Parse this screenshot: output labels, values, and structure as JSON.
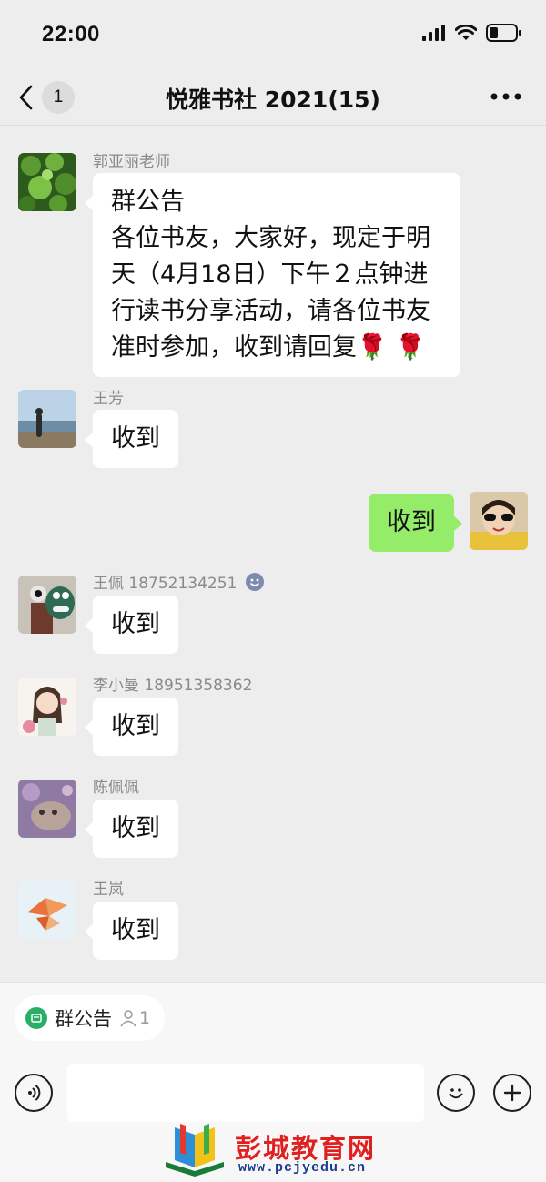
{
  "status_bar": {
    "time": "22:00"
  },
  "nav": {
    "back_count": "1",
    "title": "悦雅书社 2021(15)"
  },
  "messages": [
    {
      "sender": "郭亚丽老师",
      "notice_heading": "群公告",
      "text": "各位书友，大家好，现定于明天（4月18日）下午２点钟进行读书分享活动，请各位书友准时参加，收到请回复",
      "emoji": "🌹 🌹"
    },
    {
      "sender": "王芳",
      "text": "收到"
    },
    {
      "sender": "",
      "text": "收到"
    },
    {
      "sender": "王佩 18752134251",
      "text": "收到"
    },
    {
      "sender": "李小曼 18951358362",
      "text": "收到"
    },
    {
      "sender": "陈佩佩",
      "text": "收到"
    },
    {
      "sender": "王岚",
      "text": "收到"
    }
  ],
  "bottom": {
    "notice_label": "群公告",
    "notice_count": "1",
    "input_placeholder": ""
  },
  "watermark": {
    "title": "彭城教育网",
    "url": "www.pcjyedu.cn"
  },
  "colors": {
    "background": "#ededed",
    "own_bubble": "#95ec69",
    "other_bubble": "#ffffff",
    "accent_green": "#2aae67",
    "watermark_red": "#e01f1f"
  }
}
